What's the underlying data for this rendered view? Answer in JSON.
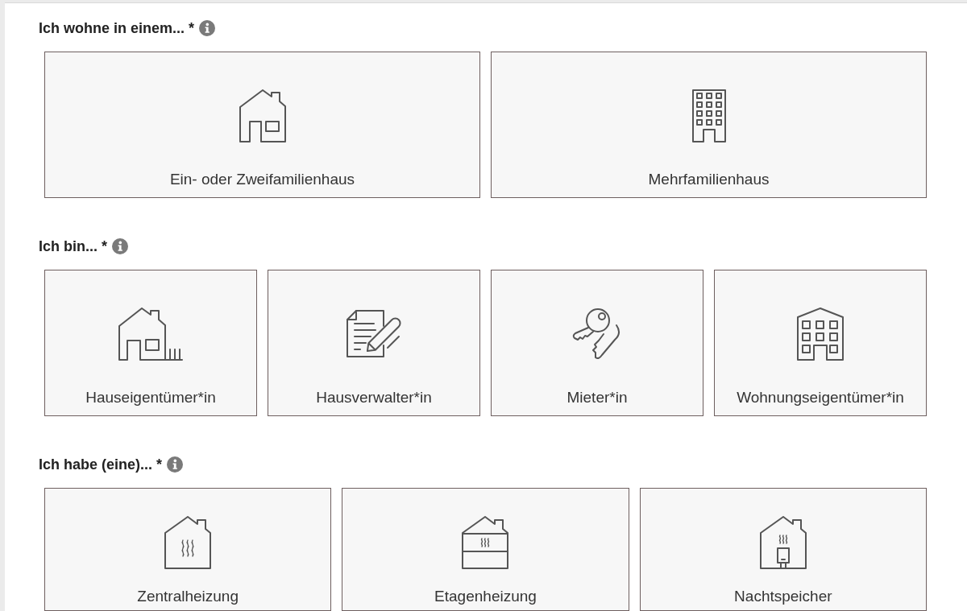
{
  "sections": [
    {
      "heading": "Ich wohne in einem... *",
      "options": [
        {
          "label": "Ein- oder Zweifamilienhaus",
          "kind": "house"
        },
        {
          "label": "Mehrfamilienhaus",
          "kind": "tower"
        }
      ]
    },
    {
      "heading": "Ich bin... *",
      "options": [
        {
          "label": "Hauseigentümer*in",
          "kind": "homeowner"
        },
        {
          "label": "Hausverwalter*in",
          "kind": "manager"
        },
        {
          "label": "Mieter*in",
          "kind": "tenant"
        },
        {
          "label": "Wohnungseigentümer*in",
          "kind": "apartment"
        }
      ]
    },
    {
      "heading": "Ich habe (eine)... *",
      "options": [
        {
          "label": "Zentralheizung",
          "kind": "central"
        },
        {
          "label": "Etagenheizung",
          "kind": "floor"
        },
        {
          "label": "Nachtspeicher",
          "kind": "storage"
        }
      ]
    }
  ]
}
